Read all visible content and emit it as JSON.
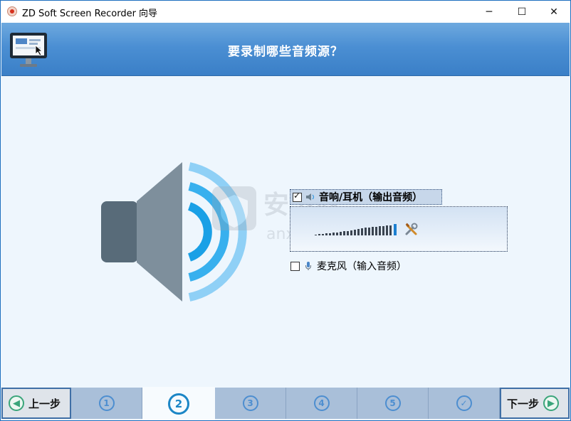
{
  "window": {
    "title": "ZD Soft Screen Recorder 向导",
    "minimize_glyph": "─",
    "maximize_glyph": "☐",
    "close_glyph": "✕"
  },
  "header": {
    "title": "要录制哪些音频源？",
    "icon": "monitor-icon"
  },
  "audio_sources": {
    "speaker": {
      "label": "音响/耳机（输出音频）",
      "checked": true,
      "icon": "speaker-icon",
      "level_percent": 100
    },
    "microphone": {
      "label": "麦克风（输入音频）",
      "checked": false,
      "icon": "microphone-icon"
    }
  },
  "nav": {
    "back_label": "上一步",
    "next_label": "下一步",
    "steps": [
      {
        "label": "1",
        "state": "normal"
      },
      {
        "label": "2",
        "state": "active"
      },
      {
        "label": "3",
        "state": "normal"
      },
      {
        "label": "4",
        "state": "normal"
      },
      {
        "label": "5",
        "state": "normal"
      },
      {
        "label": "✓",
        "state": "done"
      }
    ]
  },
  "watermark": {
    "text": "anxz.com"
  },
  "colors": {
    "header_blue": "#4b8fd3",
    "accent_blue": "#1c86c6",
    "nav_green": "#3aa57a",
    "tab_gray_blue": "#a9bfd9"
  }
}
